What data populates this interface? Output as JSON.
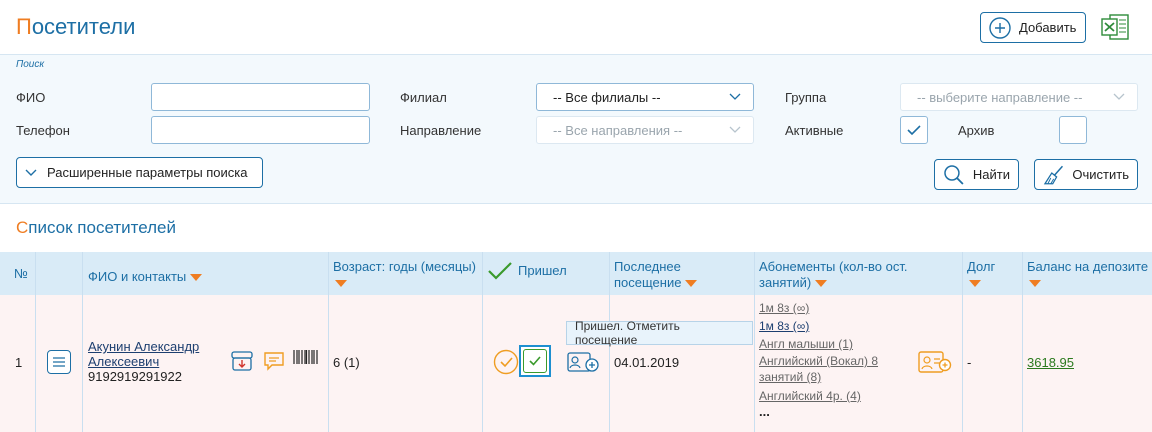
{
  "header": {
    "title_first": "П",
    "title_rest": "осетители",
    "add_label": "Добавить"
  },
  "search": {
    "caption": "Поиск",
    "fio_label": "ФИО",
    "fio_value": "",
    "phone_label": "Телефон",
    "phone_value": "",
    "branch_label": "Филиал",
    "branch_value": "-- Все филиалы --",
    "direction_label": "Направление",
    "direction_value": "-- Все направления --",
    "group_label": "Группа",
    "group_value": "-- выберите направление --",
    "active_label": "Активные",
    "active_checked": true,
    "archive_label": "Архив",
    "archive_checked": false,
    "advanced_label": "Расширенные параметры поиска",
    "find_label": "Найти",
    "clear_label": "Очистить"
  },
  "list": {
    "title_first": "С",
    "title_rest": "писок посетителей",
    "columns": {
      "num": "№",
      "name": "ФИО и контакты",
      "age": "Возраст: годы (месяцы)",
      "came": "Пришел",
      "last_visit_1": "Последнее",
      "last_visit_2": "посещение",
      "subs_1": "Абонементы (кол-во ост.",
      "subs_2": "занятий)",
      "debt": "Долг",
      "balance": "Баланс на депозите"
    },
    "rows": [
      {
        "num": "1",
        "name_line1": "Акунин Александр",
        "name_line2": "Алексеевич",
        "phone": "9192919291922",
        "age": "6 (1)",
        "last_visit": "04.01.2019",
        "subscriptions": [
          "1м 8з (∞)",
          "1м 8з (∞)",
          "Англ малыши (1)",
          "Английский (Вокал) 8",
          "занятий (8)",
          "Английский 4р. (4)",
          "..."
        ],
        "debt": "-",
        "balance": "3618.95"
      }
    ],
    "tooltip": "Пришел. Отметить посещение"
  },
  "colors": {
    "accent": "#1d6fa5",
    "orange": "#ef7d22",
    "green": "#3a9a2c",
    "row_bg": "#fdf3f3",
    "header_bg": "#d9ebf7"
  },
  "icons": [
    "add-circle-icon",
    "excel-icon",
    "chevron-down-icon",
    "check-icon",
    "search-icon",
    "broom-icon",
    "menu-icon",
    "archive-box-icon",
    "comment-icon",
    "barcode-icon",
    "add-visit-icon",
    "add-subscription-icon"
  ]
}
